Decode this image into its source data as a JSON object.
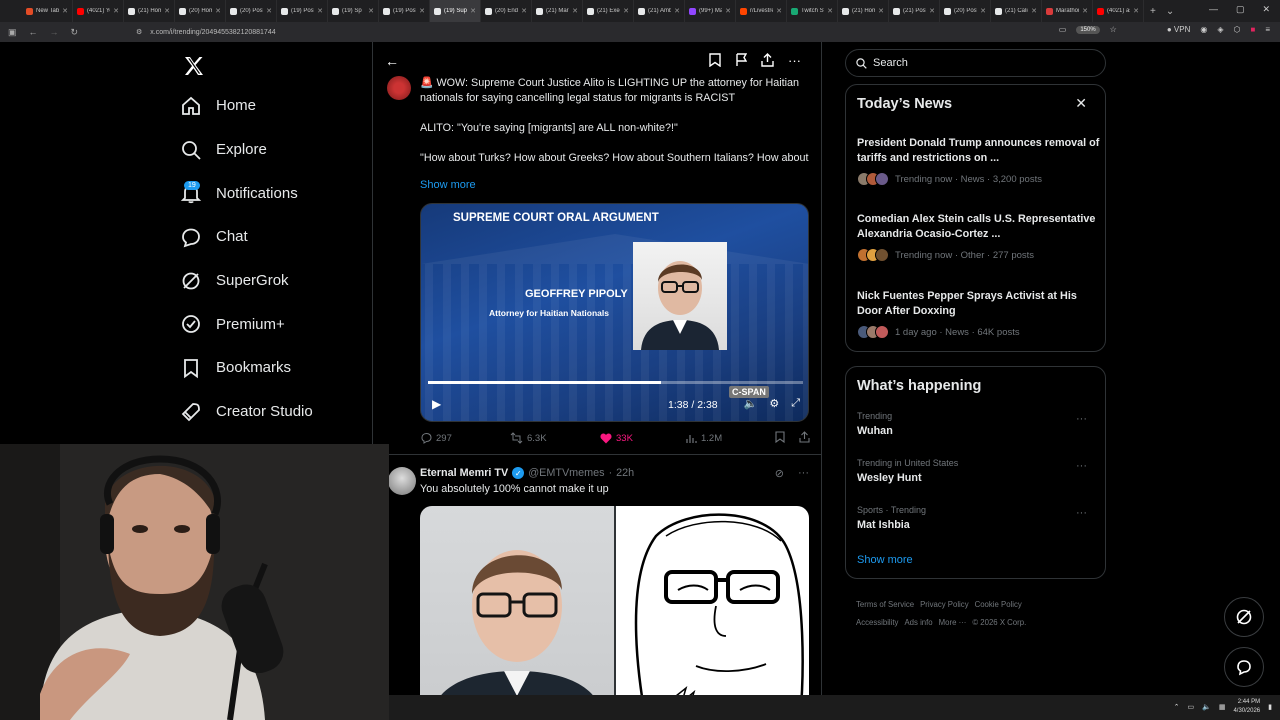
{
  "browser": {
    "tabs": [
      {
        "label": "New Tab",
        "color": "#e34c26"
      },
      {
        "label": "(4021) You",
        "color": "#ff0000"
      },
      {
        "label": "(21) Home",
        "color": "#e7e9ea"
      },
      {
        "label": "(20) Home",
        "color": "#e7e9ea"
      },
      {
        "label": "(20) Posts",
        "color": "#e7e9ea"
      },
      {
        "label": "(19) Posts",
        "color": "#e7e9ea"
      },
      {
        "label": "(19) Sp",
        "color": "#e7e9ea"
      },
      {
        "label": "(19) Posts",
        "color": "#e7e9ea"
      },
      {
        "label": "(19) Sup",
        "color": "#e7e9ea",
        "active": true
      },
      {
        "label": "(20) End W",
        "color": "#e7e9ea"
      },
      {
        "label": "(21) Mario",
        "color": "#e7e9ea"
      },
      {
        "label": "(21) Exec S",
        "color": "#e7e9ea"
      },
      {
        "label": "(21) Ambo",
        "color": "#e7e9ea"
      },
      {
        "label": "(99+) Mars",
        "color": "#9146ff"
      },
      {
        "label": "r/Livestrea",
        "color": "#ff4500"
      },
      {
        "label": "Twitch Stat",
        "color": "#19a974"
      },
      {
        "label": "(21) Home",
        "color": "#e7e9ea"
      },
      {
        "label": "(21) Posts",
        "color": "#e7e9ea"
      },
      {
        "label": "(20) Posts",
        "color": "#e7e9ea"
      },
      {
        "label": "(21) Calico",
        "color": "#e7e9ea"
      },
      {
        "label": "Marathon",
        "color": "#d93b3b"
      },
      {
        "label": "(4021) asm",
        "color": "#ff0000"
      }
    ],
    "url": "x.com/i/trending/2049455382120881744",
    "zoom": "150%",
    "vpn": "VPN"
  },
  "nav": {
    "logo": "X",
    "items": [
      {
        "label": "Home",
        "icon": "home-icon"
      },
      {
        "label": "Explore",
        "icon": "search-icon"
      },
      {
        "label": "Notifications",
        "icon": "bell-icon"
      },
      {
        "label": "Chat",
        "icon": "chat-icon"
      },
      {
        "label": "SuperGrok",
        "icon": "grok-icon"
      },
      {
        "label": "Premium+",
        "icon": "verified-icon"
      },
      {
        "label": "Bookmarks",
        "icon": "bookmark-icon"
      },
      {
        "label": "Creator Studio",
        "icon": "rocket-icon"
      }
    ],
    "notifications_badge": "19"
  },
  "post1": {
    "text_line1": "🚨 WOW: Supreme Court Justice Alito is LIGHTING UP the attorney for Haitian nationals for saying cancelling legal status for migrants is RACIST",
    "text_line2": "ALITO: \"You're saying [migrants] are ALL non-white?!\"",
    "text_line3": "\"How about Turks? How about Greeks? How about Southern Italians? How about",
    "show_more": "Show more",
    "video": {
      "headline": "SUPREME COURT ORAL ARGUMENT",
      "name": "GEOFFREY PIPOLY",
      "role": "Attorney for Haitian Nationals",
      "watermark": "C-SPAN",
      "time": "1:38 / 2:38",
      "progress": 0.62
    },
    "metrics": {
      "replies": "297",
      "reposts": "6.3K",
      "likes": "33K",
      "views": "1.2M"
    }
  },
  "post2": {
    "name": "Eternal Memri TV",
    "handle": "@EMTVmemes",
    "time": "22h",
    "text": "You absolutely 100% cannot make it up"
  },
  "sidebar": {
    "search_placeholder": "Search",
    "news_title": "Today’s News",
    "news": [
      {
        "title": "President Donald Trump announces removal of tariffs and restrictions on ...",
        "meta": "Trending now · News · 3,200 posts"
      },
      {
        "title": "Comedian Alex Stein calls U.S. Representative Alexandria Ocasio-Cortez ...",
        "meta": "Trending now · Other · 277 posts"
      },
      {
        "title": "Nick Fuentes Pepper Sprays Activist at His Door After Doxxing",
        "meta": "1 day ago · News · 64K posts"
      }
    ],
    "happening_title": "What’s happening",
    "trends": [
      {
        "category": "Trending",
        "name": "Wuhan"
      },
      {
        "category": "Trending in United States",
        "name": "Wesley Hunt"
      },
      {
        "category": "Sports · Trending",
        "name": "Mat Ishbia"
      }
    ],
    "show_more": "Show more",
    "footer": [
      "Terms of Service",
      "Privacy Policy",
      "Cookie Policy",
      "Accessibility",
      "Ads info",
      "More ···",
      "© 2026 X Corp."
    ]
  },
  "taskbar": {
    "time": "2:44 PM",
    "date": "4/30/2026"
  }
}
